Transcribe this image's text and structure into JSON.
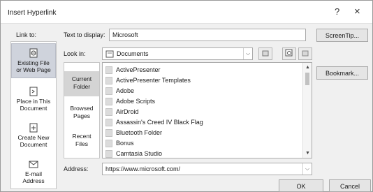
{
  "dialog": {
    "title": "Insert Hyperlink",
    "help_glyph": "?",
    "close_glyph": "×"
  },
  "link_to": {
    "label": "Link to:",
    "items": [
      {
        "line1": "Existing File",
        "line2": "or Web Page",
        "icon": "globe-document-icon",
        "selected": true
      },
      {
        "line1": "Place in This",
        "line2": "Document",
        "icon": "place-document-icon",
        "selected": false
      },
      {
        "line1": "Create New",
        "line2": "Document",
        "icon": "new-document-icon",
        "selected": false
      },
      {
        "line1": "E-mail",
        "line2": "Address",
        "icon": "email-icon",
        "selected": false
      }
    ]
  },
  "text_to_display": {
    "label": "Text to display:",
    "value": "Microsoft"
  },
  "screentip_button": "ScreenTip...",
  "look_in": {
    "label": "Look in:",
    "value": "Documents",
    "icon": "folder-icon"
  },
  "nav": {
    "items": [
      {
        "line1": "Current",
        "line2": "Folder",
        "selected": true
      },
      {
        "line1": "Browsed",
        "line2": "Pages",
        "selected": false
      },
      {
        "line1": "Recent",
        "line2": "Files",
        "selected": false
      }
    ]
  },
  "files": [
    "ActivePresenter",
    "ActivePresenter Templates",
    "Adobe",
    "Adobe Scripts",
    "AirDroid",
    "Assassin's Creed IV Black Flag",
    "Bluetooth Folder",
    "Bonus",
    "Camtasia Studio"
  ],
  "bookmark_button": "Bookmark...",
  "address": {
    "label": "Address:",
    "value": "https://www.microsoft.com/"
  },
  "ok_button": "OK",
  "cancel_button": "Cancel",
  "colors": {
    "dialog_bg": "#f0f0f0",
    "selected_link_bg": "#cfd3dc",
    "selected_nav_bg": "#d4d4d4"
  }
}
